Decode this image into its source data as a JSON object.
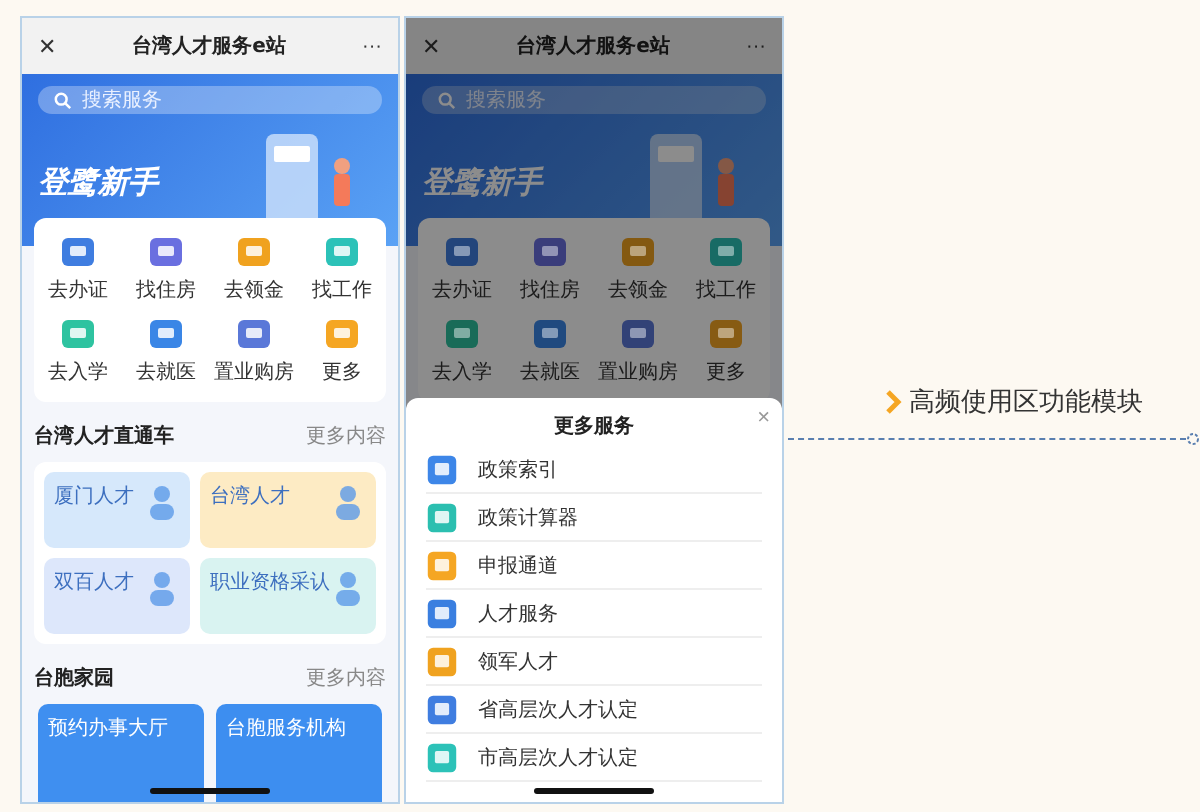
{
  "screens": [
    {
      "header": {
        "close": "✕",
        "title": "台湾人才服务e站",
        "more": "···"
      },
      "search": {
        "placeholder": "搜索服务"
      },
      "banner": {
        "title": "登鹭新手"
      },
      "dimmed": false,
      "quick_actions": [
        {
          "label": "去办证",
          "color": "#3f7de0"
        },
        {
          "label": "找住房",
          "color": "#6a6fe0"
        },
        {
          "label": "去领金",
          "color": "#f0a21f"
        },
        {
          "label": "找工作",
          "color": "#2cc2b8"
        },
        {
          "label": "去入学",
          "color": "#2ec3a0"
        },
        {
          "label": "去就医",
          "color": "#3a86e6"
        },
        {
          "label": "置业购房",
          "color": "#5a78d8"
        },
        {
          "label": "更多",
          "color": "#f5a623"
        }
      ],
      "sections": [
        {
          "title": "台湾人才直通车",
          "more": "更多内容",
          "kind": "tiles",
          "cards": [
            {
              "label": "厦门人才",
              "color": "#d6e8fb"
            },
            {
              "label": "台湾人才",
              "color": "#fdebc4"
            },
            {
              "label": "双百人才",
              "color": "#dde7fb"
            },
            {
              "label": "职业资格采认",
              "color": "#d9f3f1"
            }
          ]
        },
        {
          "title": "台胞家园",
          "more": "更多内容",
          "kind": "banners",
          "cards": [
            {
              "label": "预约办事大厅",
              "color": "#3f8ff0"
            },
            {
              "label": "台胞服务机构",
              "color": "#3d8ef0"
            }
          ]
        }
      ]
    },
    {
      "header": {
        "close": "✕",
        "title": "台湾人才服务e站",
        "more": "···"
      },
      "search": {
        "placeholder": "搜索服务"
      },
      "banner": {
        "title": "登鹭新手"
      },
      "dimmed": true,
      "quick_actions": [
        {
          "label": "去办证",
          "color": "#23457b"
        },
        {
          "label": "找住房",
          "color": "#3a3d7b"
        },
        {
          "label": "去领金",
          "color": "#845911"
        },
        {
          "label": "找工作",
          "color": "#186b65"
        },
        {
          "label": "去入学",
          "color": "#196b58"
        },
        {
          "label": "去就医",
          "color": "#204a7f"
        },
        {
          "label": "置业购房",
          "color": "#324277"
        },
        {
          "label": "更多",
          "color": "#875b13"
        }
      ],
      "sheet": {
        "title": "更多服务",
        "close": "×",
        "items": [
          {
            "label": "政策索引",
            "color": "#3d86e8"
          },
          {
            "label": "政策计算器",
            "color": "#2bbfb0"
          },
          {
            "label": "申报通道",
            "color": "#f5a623"
          },
          {
            "label": "人才服务",
            "color": "#3a7fe0"
          },
          {
            "label": "领军人才",
            "color": "#f0a21f"
          },
          {
            "label": "省高层次人才认定",
            "color": "#3f7de0"
          },
          {
            "label": "市高层次人才认定",
            "color": "#2cc2b8"
          }
        ]
      }
    }
  ],
  "annotation": {
    "text": "高频使用区功能模块"
  }
}
